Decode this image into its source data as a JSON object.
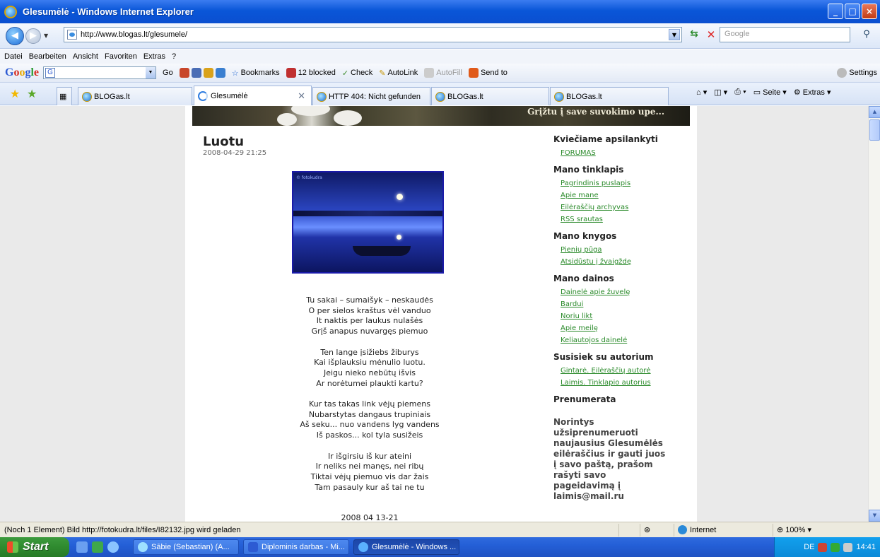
{
  "window": {
    "title": "Glesumėlė - Windows Internet Explorer",
    "min": "_",
    "max": "□",
    "close": "×"
  },
  "address": {
    "url": "http://www.blogas.lt/glesumele/",
    "search_placeholder": "Google"
  },
  "menu": [
    "Datei",
    "Bearbeiten",
    "Ansicht",
    "Favoriten",
    "Extras",
    "?"
  ],
  "google_toolbar": {
    "logo": "Google",
    "go": "Go",
    "bookmarks": "Bookmarks",
    "blocked": "12 blocked",
    "check": "Check",
    "autolink": "AutoLink",
    "autofill": "AutoFill",
    "sendto": "Send to",
    "settings": "Settings"
  },
  "tabs": [
    {
      "label": "BLOGas.lt"
    },
    {
      "label": "Glesumėlė",
      "active": true
    },
    {
      "label": "HTTP 404: Nicht gefunden"
    },
    {
      "label": "BLOGas.lt"
    },
    {
      "label": "BLOGas.lt"
    }
  ],
  "tools": {
    "seite": "Seite",
    "extras": "Extras"
  },
  "page": {
    "header_text": "Grįžtu į save suvokimo upe...",
    "post_title": "Luotu",
    "post_date": "2008-04-29 21:25",
    "poem": [
      [
        "Tu sakai – sumaišyk – neskaudės",
        "O per sielos kraštus vėl vanduo",
        "It naktis per laukus nulašės",
        "Grįš anapus nuvargęs piemuo"
      ],
      [
        "Ten  lange įsižiebs žiburys",
        "Kai išplauksiu mėnulio luotu.",
        "Jeigu nieko nebūtų išvis",
        "Ar norėtumei plaukti kartu?"
      ],
      [
        "Kur tas takas link vėjų piemens",
        "Nubarstytas dangaus trupiniais",
        "Aš seku... nuo vandens lyg vandens",
        "Iš paskos... kol tyla susižeis"
      ],
      [
        "Ir išgirsiu iš kur ateini",
        "Ir neliks nei manęs, nei ribų",
        "Tiktai vėjų piemuo vis dar žais",
        "Tam pasauly kur aš tai ne tu"
      ]
    ],
    "poem_date": "2008 04 13-21"
  },
  "sidebar": {
    "sections": [
      {
        "title": "Kviečiame apsilankyti",
        "links": [
          "FORUMAS"
        ]
      },
      {
        "title": "Mano tinklapis",
        "links": [
          "Pagrindinis puslapis",
          "Apie mane",
          "Eilėraščių archyvas",
          "RSS srautas"
        ]
      },
      {
        "title": "Mano knygos",
        "links": [
          "Pienių pūga",
          "Atsidūstu į žvaigždę"
        ]
      },
      {
        "title": "Mano dainos",
        "links": [
          "Dainelė apie žuvelę",
          "Bardui",
          "Noriu likt",
          "Apie meilę",
          "Keliautojos dainelė"
        ]
      },
      {
        "title": "Susisiek su autorium",
        "links": [
          "Gintarė. Eilėraščių autorė",
          "Laimis. Tinklapio autorius"
        ]
      },
      {
        "title": "Prenumerata",
        "links": []
      }
    ],
    "subscribe_text": "Norintys užsiprenumeruoti naujausius Glesumėlės eilėraščius ir gauti juos į savo paštą, prašom rašyti savo pageidavimą į laimis@mail.ru"
  },
  "status": {
    "message": "(Noch 1 Element) Bild http://fotokudra.lt/files/I82132.jpg wird geladen",
    "zone": "Internet",
    "zoom": "100%"
  },
  "taskbar": {
    "start": "Start",
    "tasks": [
      "Sābie (Sebastian) (A...",
      "Diplominis darbas - Mi...",
      "Glesumėlė - Windows ..."
    ],
    "lang": "DE",
    "time": "14:41"
  }
}
